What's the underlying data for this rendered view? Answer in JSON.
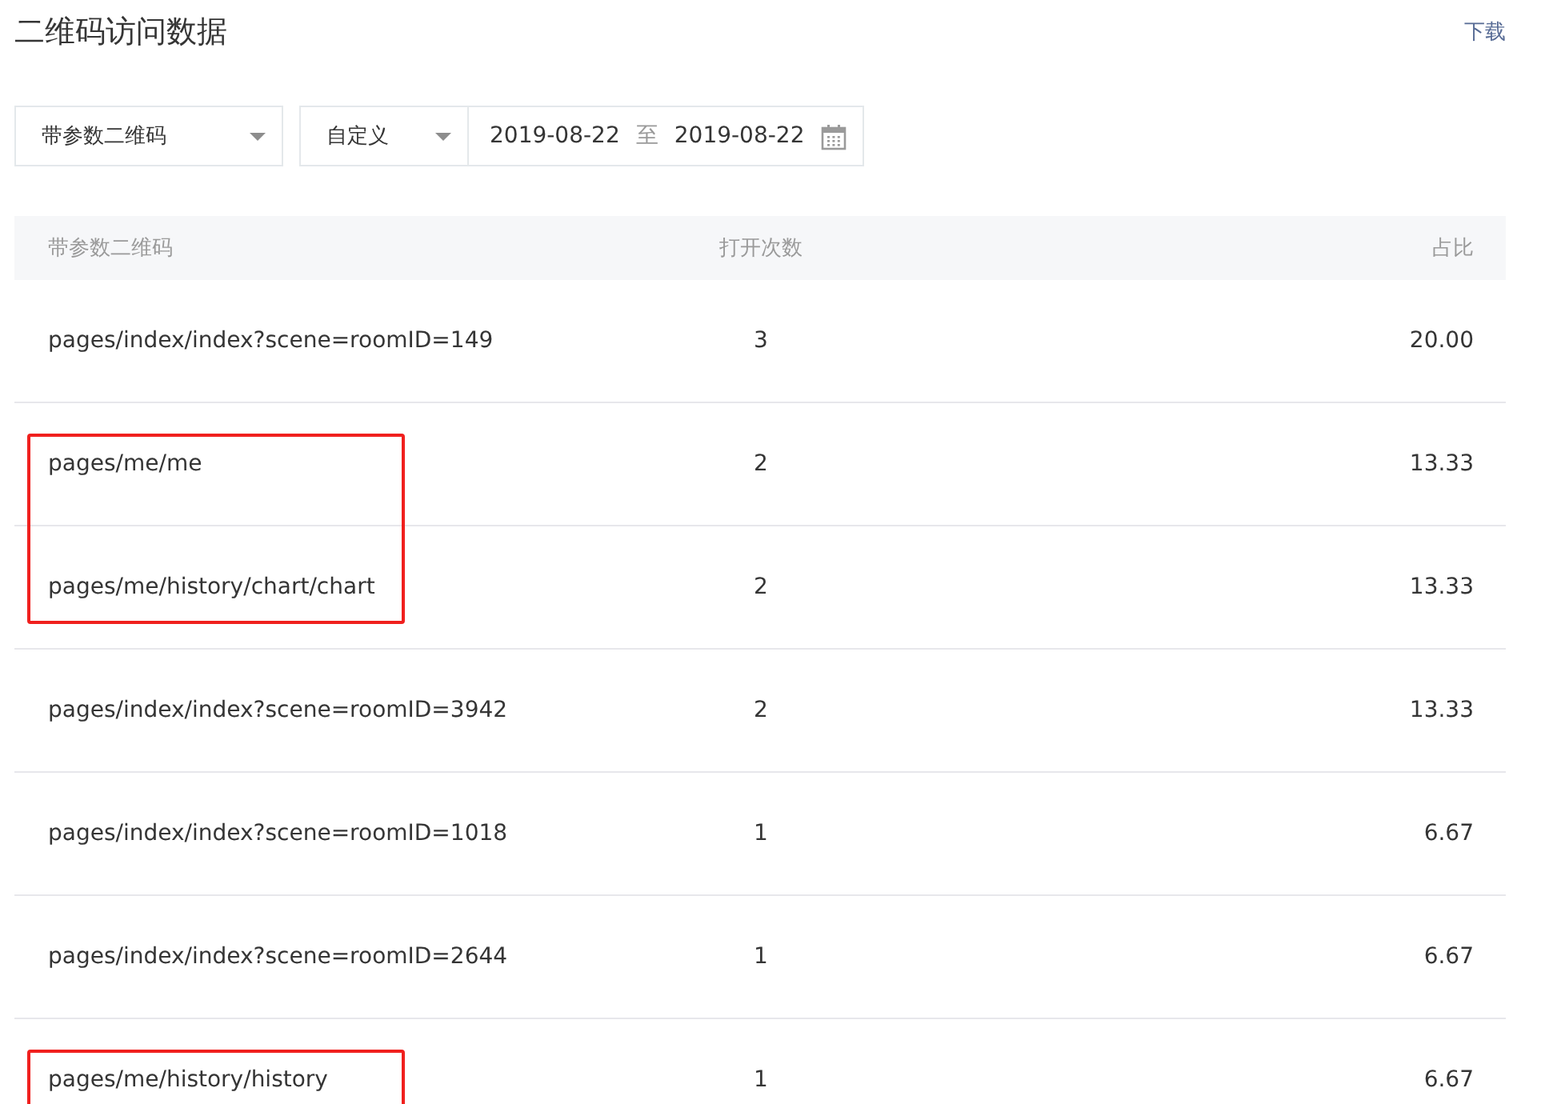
{
  "title": "二维码访问数据",
  "download_link": "下载",
  "filters": {
    "type_select": "带参数二维码",
    "range_select": "自定义",
    "date_from": "2019-08-22",
    "separator": "至",
    "date_to": "2019-08-22"
  },
  "table": {
    "columns": [
      "带参数二维码",
      "打开次数",
      "占比"
    ],
    "rows": [
      {
        "path": "pages/index/index?scene=roomID=149",
        "opens": "3",
        "share": "20.00",
        "marked": false
      },
      {
        "path": "pages/me/me",
        "opens": "2",
        "share": "13.33",
        "marked": true
      },
      {
        "path": "pages/me/history/chart/chart",
        "opens": "2",
        "share": "13.33",
        "marked": true
      },
      {
        "path": "pages/index/index?scene=roomID=3942",
        "opens": "2",
        "share": "13.33",
        "marked": false
      },
      {
        "path": "pages/index/index?scene=roomID=1018",
        "opens": "1",
        "share": "6.67",
        "marked": false
      },
      {
        "path": "pages/index/index?scene=roomID=2644",
        "opens": "1",
        "share": "6.67",
        "marked": false
      },
      {
        "path": "pages/me/history/history",
        "opens": "1",
        "share": "6.67",
        "marked": true
      }
    ]
  }
}
